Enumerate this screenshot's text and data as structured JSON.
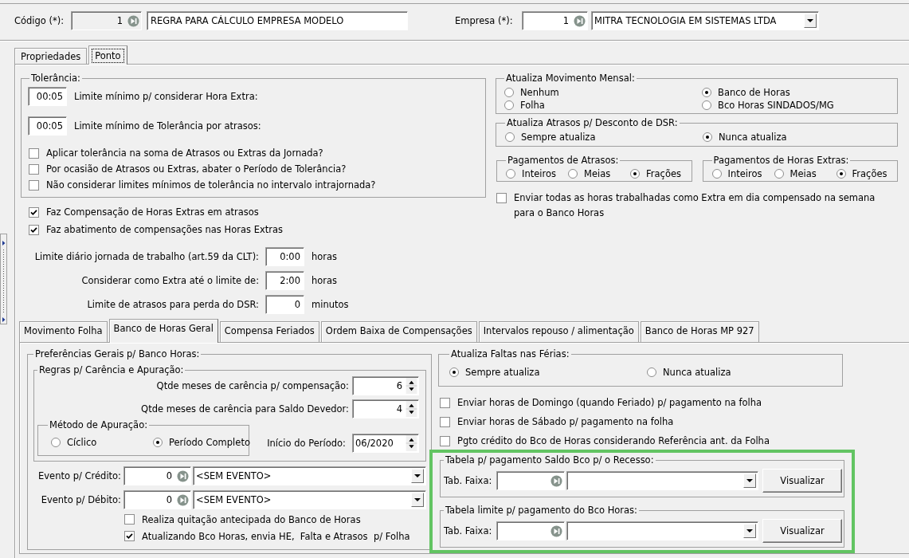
{
  "header": {
    "code": {
      "label": "Código (*):",
      "value": "1",
      "disabled": true,
      "description": "REGRA PARA CÁLCULO EMPRESA MODELO"
    },
    "company": {
      "label": "Empresa (*):",
      "value": "1",
      "name": "MITRA TECNOLOGIA EM SISTEMAS LTDA"
    }
  },
  "tabs": [
    {
      "label": "Propriedades",
      "selected": false
    },
    {
      "label": "Ponto",
      "selected": true
    }
  ],
  "tolerance": {
    "title": "Tolerância:",
    "limits": [
      {
        "value": "00:05",
        "label": "Limite mínimo p/ considerar Hora Extra:"
      },
      {
        "value": "00:05",
        "label": "Limite mínimo de Tolerância por atrasos:"
      }
    ],
    "options": [
      {
        "label": "Aplicar tolerância na soma de Atrasos ou Extras da Jornada?",
        "checked": false
      },
      {
        "label": "Por ocasião de Atrasos ou Extras, abater o Período de Tolerância?",
        "checked": false
      },
      {
        "label": "Não considerar limites mínimos de tolerância no intervalo intrajornada?",
        "checked": false
      }
    ]
  },
  "compensation": [
    {
      "label": "Faz Compensação de Horas Extras em atrasos",
      "checked": true
    },
    {
      "label": "Faz abatimento de compensações nas Horas Extras",
      "checked": true
    }
  ],
  "journey_limits": [
    {
      "label": "Limite diário jornada de trabalho (art.59 da CLT):",
      "value": "0:00",
      "unit": "horas"
    },
    {
      "label": "Considerar como Extra até o limite de:",
      "value": "2:00",
      "unit": "horas"
    },
    {
      "label": "Limite de atrasos para perda do DSR:",
      "value": "0",
      "unit": "minutos"
    }
  ],
  "monthly_update": {
    "title": "Atualiza Movimento Mensal:",
    "options": [
      {
        "label": "Nenhum",
        "selected": false
      },
      {
        "label": "Banco de Horas",
        "selected": true
      },
      {
        "label": "Folha",
        "selected": false
      },
      {
        "label": "Bco Horas SINDADOS/MG",
        "selected": false
      }
    ]
  },
  "dsr_delays": {
    "title": "Atualiza Atrasos p/ Desconto de DSR:",
    "options": [
      {
        "label": "Sempre atualiza",
        "selected": false
      },
      {
        "label": "Nunca atualiza",
        "selected": true
      }
    ]
  },
  "payments": [
    {
      "title": "Pagamentos de Atrasos:",
      "options": [
        {
          "label": "Inteiros",
          "selected": false
        },
        {
          "label": "Meias",
          "selected": false
        },
        {
          "label": "Frações",
          "selected": true
        }
      ]
    },
    {
      "title": "Pagamentos de Horas Extras:",
      "options": [
        {
          "label": "Inteiros",
          "selected": false
        },
        {
          "label": "Meias",
          "selected": false
        },
        {
          "label": "Frações",
          "selected": true
        }
      ]
    }
  ],
  "send_all_hours": {
    "label": "Enviar todas as horas trabalhadas como Extra em dia compensado na semana para o Banco Horas",
    "checked": false
  },
  "sub_tabs": [
    {
      "label": "Movimento Folha",
      "selected": false
    },
    {
      "label": "Banco de Horas Geral",
      "selected": true
    },
    {
      "label": "Compensa Feriados",
      "selected": false
    },
    {
      "label": "Ordem Baixa de Compensações",
      "selected": false
    },
    {
      "label": "Intervalos repouso / alimentação",
      "selected": false
    },
    {
      "label": "Banco de Horas MP 927",
      "selected": false
    }
  ],
  "bank_preferences": {
    "title": "Preferências Gerais p/ Banco Horas:",
    "rules": {
      "title": "Regras p/ Carência e Apuração:",
      "grace_fields": [
        {
          "label": "Qtde meses de carência p/ compensação:",
          "value": "6"
        },
        {
          "label": "Qtde meses de carência para Saldo Devedor:",
          "value": "4"
        }
      ],
      "method": {
        "title": "Método de Apuração:",
        "options": [
          {
            "label": "Cíclico",
            "selected": false
          },
          {
            "label": "Período Completo",
            "selected": true
          }
        ]
      },
      "period_start": {
        "label": "Início do Período:",
        "value": "06/2020"
      }
    },
    "events": [
      {
        "label": "Evento p/ Crédito:",
        "code": "0",
        "name": "<SEM EVENTO>"
      },
      {
        "label": "Evento p/ Débito:",
        "code": "0",
        "name": "<SEM EVENTO>"
      }
    ],
    "options": [
      {
        "label": "Realiza quitação antecipada do Banco de Horas",
        "checked": false
      },
      {
        "label": "Atualizando Bco Horas, envia HE,  Falta e Atrasos  p/ Folha",
        "checked": true
      }
    ]
  },
  "vacation_absences": {
    "title": "Atualiza Faltas nas Férias:",
    "options": [
      {
        "label": "Sempre atualiza",
        "selected": true
      },
      {
        "label": "Nunca atualiza",
        "selected": false
      }
    ]
  },
  "payroll_options": [
    {
      "label": "Enviar horas de Domingo (quando Feriado) p/ pagamento na folha",
      "checked": false
    },
    {
      "label": "Enviar horas de Sábado p/ pagamento na folha",
      "checked": false
    },
    {
      "label": "Pgto crédito do Bco de Horas considerando Referência ant. da Folha",
      "checked": false
    }
  ],
  "payment_tables": {
    "highlighted": true,
    "groups": [
      {
        "title": "Tabela p/ pagamento Saldo Bco p/ o Recesso:",
        "field_label": "Tab. Faixa:",
        "button": "Visualizar"
      },
      {
        "title": "Tabela limite p/ pagamento do Bco Horas:",
        "field_label": "Tab. Faixa:",
        "button": "Visualizar"
      }
    ]
  }
}
